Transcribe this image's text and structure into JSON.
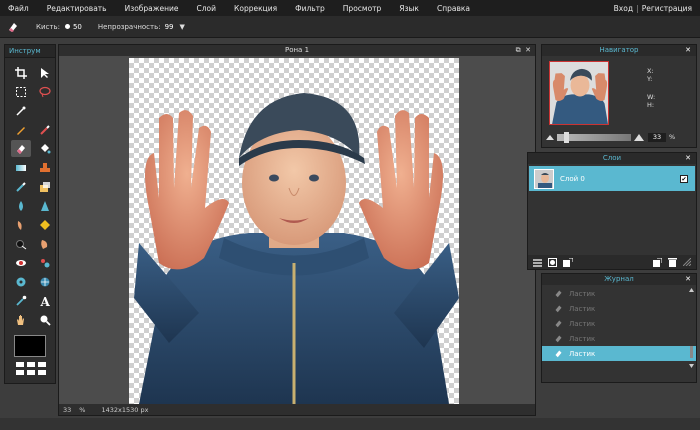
{
  "menubar": {
    "items": [
      "Файл",
      "Редактировать",
      "Изображение",
      "Слой",
      "Коррекция",
      "Фильтр",
      "Просмотр",
      "Язык",
      "Справка"
    ],
    "right": {
      "login": "Вход",
      "separator": "|",
      "register": "Регистрация"
    }
  },
  "options": {
    "brush_label": "Кисть:",
    "brush_size": "50",
    "opacity_label": "Непрозрачность:",
    "opacity_value": "99"
  },
  "toolbox": {
    "title": "Инструм",
    "tools": [
      "crop-icon",
      "move-icon",
      "marquee-icon",
      "lasso-icon",
      "magic-wand-icon",
      "pencil-icon",
      "brush-icon",
      "eraser-icon",
      "bucket-icon",
      "gradient-icon",
      "stamp-icon",
      "color-replace-icon",
      "patch-icon",
      "drop-icon",
      "triangle-icon",
      "smudge-icon",
      "sharpen-icon",
      "sponge-icon",
      "burn-icon",
      "dodge-icon",
      "red-eye-icon",
      "bloat-icon",
      "pinch-icon",
      "pipette-icon",
      "text-icon",
      "hand-icon",
      "zoom-icon"
    ],
    "primary_color": "#000000"
  },
  "document": {
    "title": "Рона 1",
    "zoom": "33",
    "zoom_unit": "%",
    "dimensions": "1432x1530 px"
  },
  "navigator": {
    "title": "Навигатор",
    "x_label": "X:",
    "y_label": "Y:",
    "w_label": "W:",
    "h_label": "H:",
    "zoom_value": "33",
    "zoom_level": 0.1
  },
  "layers": {
    "title": "Слои",
    "items": [
      {
        "name": "Слой 0",
        "visible": true,
        "visible_mark": "✔"
      }
    ]
  },
  "history": {
    "title": "Журнал",
    "items": [
      "Ластик",
      "Ластик",
      "Ластик",
      "Ластик",
      "Ластик"
    ],
    "selected_index": 4
  },
  "colors": {
    "accent": "#5ab8d0",
    "menubar_bg": "#1e1e1e",
    "panel_bg": "#333333"
  }
}
